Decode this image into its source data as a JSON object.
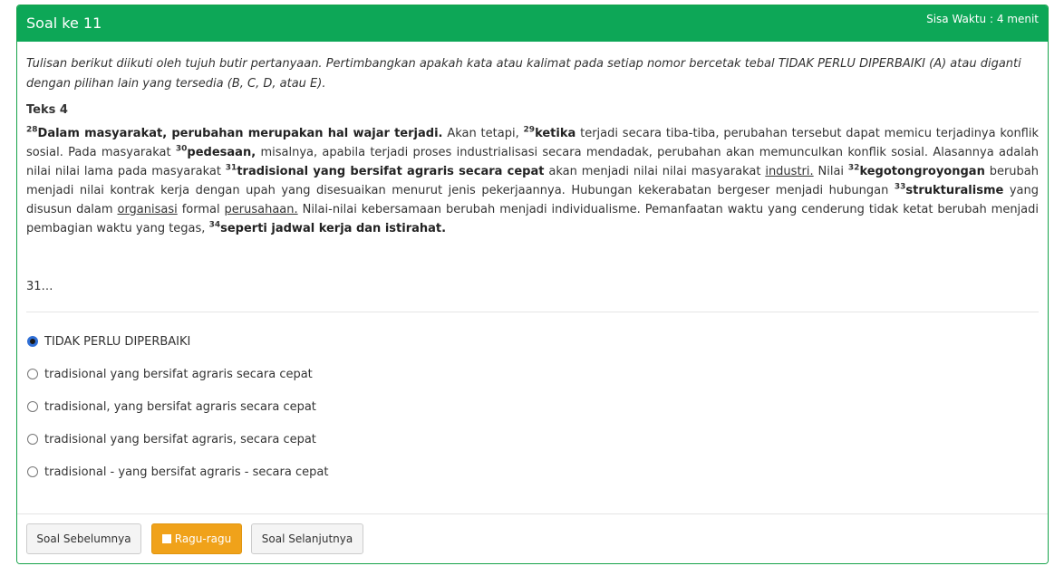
{
  "header": {
    "title": "Soal ke 11",
    "timer": "Sisa Waktu : 4 menit"
  },
  "instruction": "Tulisan berikut diikuti oleh tujuh butir pertanyaan. Pertimbangkan apakah kata atau kalimat pada setiap nomor bercetak tebal TIDAK PERLU DIPERBAIKI (A) atau diganti dengan pilihan lain yang tersedia (B, C, D, atau E).",
  "text_label": "Teks 4",
  "passage": {
    "n28": "28",
    "s28": "Dalam masyarakat, perubahan merupakan hal wajar terjadi.",
    "t1": " Akan tetapi, ",
    "n29": "29",
    "s29": "ketika",
    "t2": " terjadi secara tiba-tiba, perubahan tersebut dapat memicu terjadinya konflik sosial. Pada masyarakat ",
    "n30": "30",
    "s30": "pedesaan,",
    "t3": " misalnya, apabila terjadi proses industrialisasi secara mendadak, perubahan akan memunculkan konflik sosial. Alasannya adalah nilai nilai lama pada masyarakat ",
    "n31": "31",
    "s31": "tradisional yang bersifat agraris secara cepat",
    "t4": " akan menjadi nilai nilai masyarakat ",
    "u1": "industri.",
    "t5": " Nilai ",
    "n32": "32",
    "s32": "kegotongroyongan",
    "t6": " berubah menjadi nilai kontrak kerja dengan upah yang disesuaikan menurut jenis pekerjaannya. Hubungan kekerabatan bergeser menjadi hubungan ",
    "n33": "33",
    "s33": "strukturalisme",
    "t7": " yang disusun dalam ",
    "u2": "organisasi",
    "t8": " formal ",
    "u3": "perusahaan.",
    "t9": " Nilai-nilai kebersamaan berubah menjadi individualisme. Pemanfaatan waktu yang cenderung tidak ketat berubah menjadi pembagian waktu yang tegas, ",
    "n34": "34",
    "s34": "seperti jadwal kerja dan istirahat."
  },
  "question_number": "31…",
  "options": [
    {
      "label": "TIDAK PERLU DIPERBAIKI",
      "selected": true
    },
    {
      "label": "tradisional yang bersifat agraris secara cepat",
      "selected": false
    },
    {
      "label": "tradisional, yang bersifat agraris secara cepat",
      "selected": false
    },
    {
      "label": "tradisional yang bersifat agraris, secara cepat",
      "selected": false
    },
    {
      "label": "tradisional - yang bersifat agraris - secara cepat",
      "selected": false
    }
  ],
  "footer": {
    "prev_label": "Soal Sebelumnya",
    "doubt_label": "Ragu-ragu",
    "next_label": "Soal Selanjutnya"
  },
  "colors": {
    "header_bg": "#0da757",
    "doubt_button": "#f0a21a",
    "selected_radio": "#2f6fd6"
  }
}
